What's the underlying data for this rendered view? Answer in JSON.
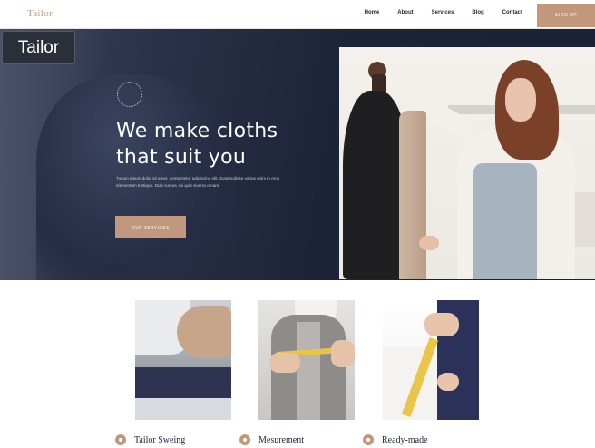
{
  "nav": {
    "brand": "Tailor",
    "links": [
      "Home",
      "About",
      "Services",
      "Blog",
      "Contact"
    ],
    "cta": "SIGN UP"
  },
  "hero": {
    "title_line1": "We make cloths",
    "title_line2": "that suit you",
    "body": "Tusum ipsum dolor sit amet, consectetur adipiscing elit. Suspendisse varius enim in eros elementum tristique. Duis cursus, mi quis viverra ornare.",
    "button": "OUR SERVICES"
  },
  "cards": [
    {
      "label": "Tailor Sweing",
      "icon": "needle-icon"
    },
    {
      "label": "Mesurement",
      "icon": "tape-icon"
    },
    {
      "label": "Ready-made",
      "icon": "hanger-icon"
    }
  ],
  "overlay": {
    "label": "Tailor"
  },
  "colors": {
    "accent": "#c2987d",
    "hero_bg": "#1e2438",
    "text_dark": "#1e2235"
  }
}
